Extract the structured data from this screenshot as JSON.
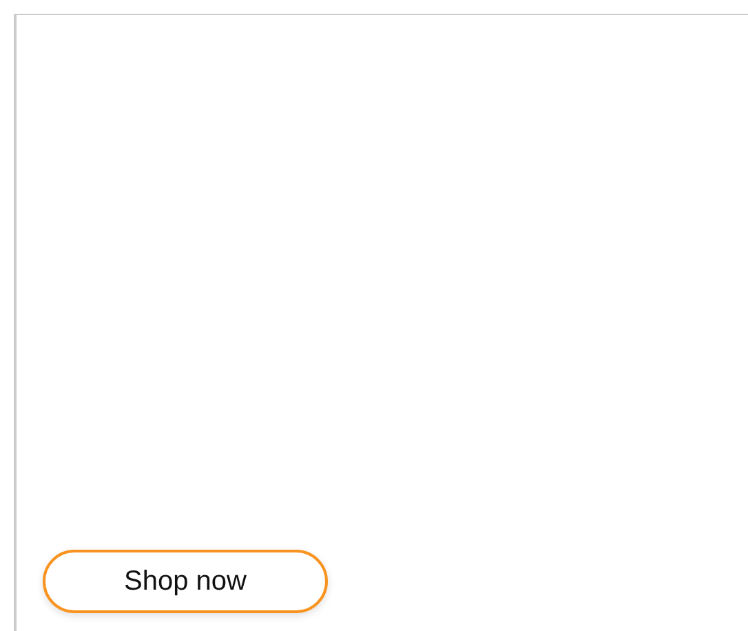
{
  "button": {
    "label": "Shop now"
  }
}
